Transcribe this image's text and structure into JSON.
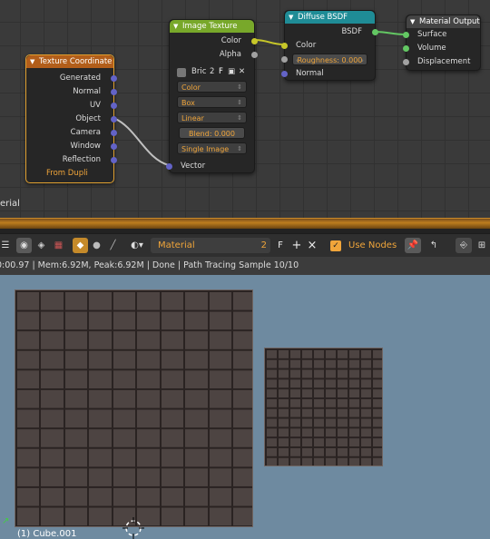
{
  "nodes": {
    "texture_coordinate": {
      "title": "Texture Coordinate",
      "outputs": [
        "Generated",
        "Normal",
        "UV",
        "Object",
        "Camera",
        "Window",
        "Reflection"
      ],
      "from_dupli": "From Dupli"
    },
    "image_texture": {
      "title": "Image Texture",
      "outputs": [
        "Color",
        "Alpha"
      ],
      "image_name": "Bric",
      "image_users": "2",
      "fake_user": "F",
      "color_space": "Color",
      "projection": "Box",
      "interpolation": "Linear",
      "blend_label": "Blend:",
      "blend_value": "0.000",
      "extension": "Single Image",
      "input_vector": "Vector"
    },
    "diffuse_bsdf": {
      "title": "Diffuse BSDF",
      "output": "BSDF",
      "input_color": "Color",
      "roughness_label": "Roughness:",
      "roughness_value": "0.000",
      "input_normal": "Normal"
    },
    "material_output": {
      "title": "Material Output",
      "inputs": [
        "Surface",
        "Volume",
        "Displacement"
      ]
    }
  },
  "editor_label": "erial",
  "toolbar": {
    "material_label": "Material",
    "users": "2",
    "fake": "F",
    "add": "+",
    "remove": "×",
    "use_nodes": "Use Nodes"
  },
  "status": "0:00.97 | Mem:6.92M, Peak:6.92M | Done | Path Tracing Sample 10/10",
  "viewport": {
    "object_label": "(1) Cube.001"
  },
  "colors": {
    "texture_header": "#b25e1a",
    "image_header": "#78a82a",
    "diffuse_header": "#1f8c96",
    "output_header": "#4a4a4a",
    "socket_color": "#c7c729",
    "socket_shader": "#63c763",
    "socket_vector": "#6363c7",
    "accent": "#f0a53a"
  }
}
